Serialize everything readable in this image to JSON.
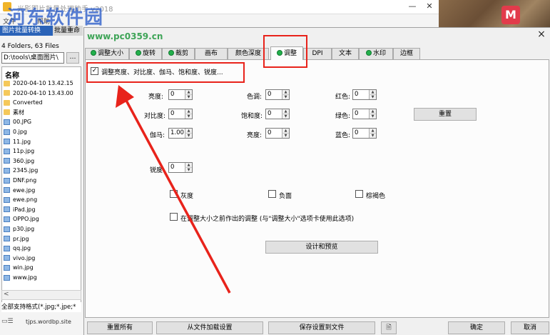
{
  "app": {
    "title": "光影图片批量处理助手 v2018",
    "watermark": "河东软件园",
    "watermark_url": "www.pc0359.cn",
    "photo_badge": "M",
    "menus": [
      "文件",
      "帮助"
    ],
    "toolbar_tabs": [
      "图片批量转换",
      "批量重命"
    ],
    "minimize": "—",
    "close": "✕"
  },
  "file_panel": {
    "folder_count": "4 Folders, 63 Files",
    "path": "D:\\tools\\桌面图片\\",
    "path_button": "…",
    "column_name": "名称",
    "items": [
      {
        "name": "2020-04-10 13.42.15",
        "type": "folder"
      },
      {
        "name": "2020-04-10 13.43.00",
        "type": "folder"
      },
      {
        "name": "Converted",
        "type": "folder"
      },
      {
        "name": "素材",
        "type": "folder"
      },
      {
        "name": "00.JPG",
        "type": "image"
      },
      {
        "name": "0.jpg",
        "type": "image"
      },
      {
        "name": "11.jpg",
        "type": "image"
      },
      {
        "name": "11p.jpg",
        "type": "image"
      },
      {
        "name": "360.jpg",
        "type": "image"
      },
      {
        "name": "2345.jpg",
        "type": "image"
      },
      {
        "name": "DNF.png",
        "type": "image"
      },
      {
        "name": "ewe.jpg",
        "type": "image"
      },
      {
        "name": "ewe.png",
        "type": "image"
      },
      {
        "name": "iPad.jpg",
        "type": "image"
      },
      {
        "name": "OPPO.jpg",
        "type": "image"
      },
      {
        "name": "p30.jpg",
        "type": "image"
      },
      {
        "name": "pr.jpg",
        "type": "image"
      },
      {
        "name": "qq.jpg",
        "type": "image"
      },
      {
        "name": "vivo.jpg",
        "type": "image"
      },
      {
        "name": "win.jpg",
        "type": "image"
      },
      {
        "name": "www.jpg",
        "type": "image"
      }
    ],
    "scroll_left": "<",
    "status": "全部支持格式(*.jpg;*.jpe;*",
    "status_icon": "▭☰",
    "site": "tjps.wordbp.site"
  },
  "dialog": {
    "close": "×",
    "tabs": [
      {
        "label": "调整大小",
        "dot": true,
        "active": false
      },
      {
        "label": "旋转",
        "dot": true,
        "active": false
      },
      {
        "label": "裁剪",
        "dot": true,
        "active": false
      },
      {
        "label": "画布",
        "dot": false,
        "active": false
      },
      {
        "label": "颜色深度",
        "dot": false,
        "active": false
      },
      {
        "label": "调整",
        "dot": true,
        "active": true
      },
      {
        "label": "DPI",
        "dot": false,
        "active": false
      },
      {
        "label": "文本",
        "dot": false,
        "active": false
      },
      {
        "label": "水印",
        "dot": true,
        "active": false
      },
      {
        "label": "边框",
        "dot": false,
        "active": false
      }
    ],
    "adjust": {
      "enable_label": "调整亮度、对比度、伽马、饱和度、锐度...",
      "enable_checked": "✓",
      "brightness_label": "亮度:",
      "brightness_value": "0",
      "contrast_label": "对比度:",
      "contrast_value": "0",
      "gamma_label": "伽马:",
      "gamma_value": "1.00",
      "hue_label": "色调:",
      "hue_value": "0",
      "saturation_label": "饱和度:",
      "saturation_value": "0",
      "lightness_label": "亮度:",
      "lightness_value": "0",
      "red_label": "红色:",
      "red_value": "0",
      "green_label": "绿色:",
      "green_value": "0",
      "blue_label": "蓝色:",
      "blue_value": "0",
      "sharpness_label": "锐度:",
      "sharpness_value": "0",
      "reset_button": "重置",
      "grayscale_label": "灰度",
      "negative_label": "负面",
      "sepia_label": "棕褐色",
      "before_resize_label": "在调整大小之前作出的调整 (与\"调整大小\"选项卡使用此选项)",
      "design_preview_button": "设计和预览",
      "spin_up": "▲",
      "spin_down": "▼"
    },
    "footer": {
      "reset_all": "重置所有",
      "load_settings": "从文件加载设置",
      "save_settings": "保存设置到文件",
      "preview_icon": "🗎",
      "ok": "确定",
      "cancel": "取消"
    }
  },
  "annotation_color": "#e8231b"
}
